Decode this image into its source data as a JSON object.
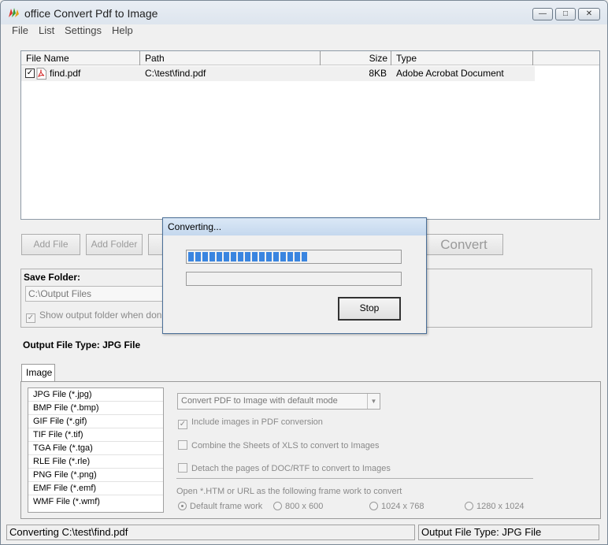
{
  "window": {
    "title": "office Convert Pdf to Image"
  },
  "menu": [
    "File",
    "List",
    "Settings",
    "Help"
  ],
  "filelist": {
    "columns": [
      "File Name",
      "Path",
      "Size",
      "Type"
    ],
    "rows": [
      {
        "checked": true,
        "name": "find.pdf",
        "path": "C:\\test\\find.pdf",
        "size": "8KB",
        "type": "Adobe Acrobat Document"
      }
    ]
  },
  "buttons": {
    "add_file": "Add File",
    "add_folder": "Add Folder",
    "partial": "A",
    "convert": "Convert"
  },
  "save": {
    "label": "Save Folder:",
    "folder": "C:\\Output Files",
    "show_output": "Show output folder when done"
  },
  "output_type": "Output File Type:  JPG File",
  "tab": {
    "label": "Image"
  },
  "formats": [
    "JPG File  (*.jpg)",
    "BMP File  (*.bmp)",
    "GIF File  (*.gif)",
    "TIF File  (*.tif)",
    "TGA File  (*.tga)",
    "RLE File  (*.rle)",
    "PNG File  (*.png)",
    "EMF File  (*.emf)",
    "WMF File  (*.wmf)"
  ],
  "options": {
    "mode": "Convert PDF to Image with default mode",
    "include_images": "Include images in PDF conversion",
    "combine_sheets": "Combine the Sheets of XLS to convert to Images",
    "detach_pages": "Detach the pages of DOC/RTF to convert to Images",
    "open_html": "Open *.HTM or URL as the following frame work to convert",
    "frames": [
      "Default frame work",
      "800 x 600",
      "1024 x 768",
      "1280 x 1024"
    ]
  },
  "status": {
    "left": "Converting  C:\\test\\find.pdf",
    "right": "Output File Type:  JPG File"
  },
  "dialog": {
    "title": "Converting...",
    "progress": 0.58,
    "stop": "Stop"
  },
  "colors": {
    "progress": "#3a85e0",
    "titlebar": "#dde5ee"
  }
}
